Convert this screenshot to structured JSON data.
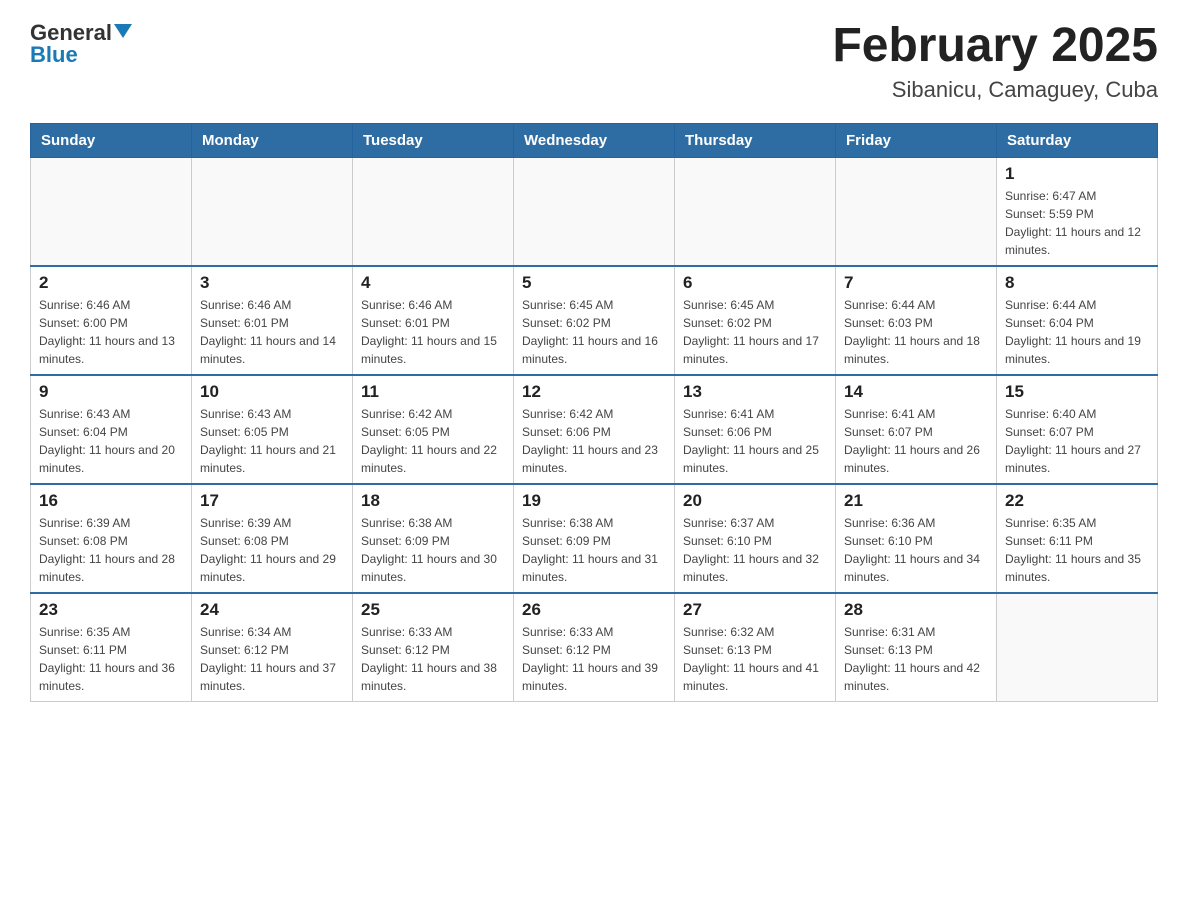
{
  "header": {
    "logo_general": "General",
    "logo_blue": "Blue",
    "title": "February 2025",
    "subtitle": "Sibanicu, Camaguey, Cuba"
  },
  "days_of_week": [
    "Sunday",
    "Monday",
    "Tuesday",
    "Wednesday",
    "Thursday",
    "Friday",
    "Saturday"
  ],
  "weeks": [
    [
      {
        "day": "",
        "info": ""
      },
      {
        "day": "",
        "info": ""
      },
      {
        "day": "",
        "info": ""
      },
      {
        "day": "",
        "info": ""
      },
      {
        "day": "",
        "info": ""
      },
      {
        "day": "",
        "info": ""
      },
      {
        "day": "1",
        "info": "Sunrise: 6:47 AM\nSunset: 5:59 PM\nDaylight: 11 hours and 12 minutes."
      }
    ],
    [
      {
        "day": "2",
        "info": "Sunrise: 6:46 AM\nSunset: 6:00 PM\nDaylight: 11 hours and 13 minutes."
      },
      {
        "day": "3",
        "info": "Sunrise: 6:46 AM\nSunset: 6:01 PM\nDaylight: 11 hours and 14 minutes."
      },
      {
        "day": "4",
        "info": "Sunrise: 6:46 AM\nSunset: 6:01 PM\nDaylight: 11 hours and 15 minutes."
      },
      {
        "day": "5",
        "info": "Sunrise: 6:45 AM\nSunset: 6:02 PM\nDaylight: 11 hours and 16 minutes."
      },
      {
        "day": "6",
        "info": "Sunrise: 6:45 AM\nSunset: 6:02 PM\nDaylight: 11 hours and 17 minutes."
      },
      {
        "day": "7",
        "info": "Sunrise: 6:44 AM\nSunset: 6:03 PM\nDaylight: 11 hours and 18 minutes."
      },
      {
        "day": "8",
        "info": "Sunrise: 6:44 AM\nSunset: 6:04 PM\nDaylight: 11 hours and 19 minutes."
      }
    ],
    [
      {
        "day": "9",
        "info": "Sunrise: 6:43 AM\nSunset: 6:04 PM\nDaylight: 11 hours and 20 minutes."
      },
      {
        "day": "10",
        "info": "Sunrise: 6:43 AM\nSunset: 6:05 PM\nDaylight: 11 hours and 21 minutes."
      },
      {
        "day": "11",
        "info": "Sunrise: 6:42 AM\nSunset: 6:05 PM\nDaylight: 11 hours and 22 minutes."
      },
      {
        "day": "12",
        "info": "Sunrise: 6:42 AM\nSunset: 6:06 PM\nDaylight: 11 hours and 23 minutes."
      },
      {
        "day": "13",
        "info": "Sunrise: 6:41 AM\nSunset: 6:06 PM\nDaylight: 11 hours and 25 minutes."
      },
      {
        "day": "14",
        "info": "Sunrise: 6:41 AM\nSunset: 6:07 PM\nDaylight: 11 hours and 26 minutes."
      },
      {
        "day": "15",
        "info": "Sunrise: 6:40 AM\nSunset: 6:07 PM\nDaylight: 11 hours and 27 minutes."
      }
    ],
    [
      {
        "day": "16",
        "info": "Sunrise: 6:39 AM\nSunset: 6:08 PM\nDaylight: 11 hours and 28 minutes."
      },
      {
        "day": "17",
        "info": "Sunrise: 6:39 AM\nSunset: 6:08 PM\nDaylight: 11 hours and 29 minutes."
      },
      {
        "day": "18",
        "info": "Sunrise: 6:38 AM\nSunset: 6:09 PM\nDaylight: 11 hours and 30 minutes."
      },
      {
        "day": "19",
        "info": "Sunrise: 6:38 AM\nSunset: 6:09 PM\nDaylight: 11 hours and 31 minutes."
      },
      {
        "day": "20",
        "info": "Sunrise: 6:37 AM\nSunset: 6:10 PM\nDaylight: 11 hours and 32 minutes."
      },
      {
        "day": "21",
        "info": "Sunrise: 6:36 AM\nSunset: 6:10 PM\nDaylight: 11 hours and 34 minutes."
      },
      {
        "day": "22",
        "info": "Sunrise: 6:35 AM\nSunset: 6:11 PM\nDaylight: 11 hours and 35 minutes."
      }
    ],
    [
      {
        "day": "23",
        "info": "Sunrise: 6:35 AM\nSunset: 6:11 PM\nDaylight: 11 hours and 36 minutes."
      },
      {
        "day": "24",
        "info": "Sunrise: 6:34 AM\nSunset: 6:12 PM\nDaylight: 11 hours and 37 minutes."
      },
      {
        "day": "25",
        "info": "Sunrise: 6:33 AM\nSunset: 6:12 PM\nDaylight: 11 hours and 38 minutes."
      },
      {
        "day": "26",
        "info": "Sunrise: 6:33 AM\nSunset: 6:12 PM\nDaylight: 11 hours and 39 minutes."
      },
      {
        "day": "27",
        "info": "Sunrise: 6:32 AM\nSunset: 6:13 PM\nDaylight: 11 hours and 41 minutes."
      },
      {
        "day": "28",
        "info": "Sunrise: 6:31 AM\nSunset: 6:13 PM\nDaylight: 11 hours and 42 minutes."
      },
      {
        "day": "",
        "info": ""
      }
    ]
  ]
}
